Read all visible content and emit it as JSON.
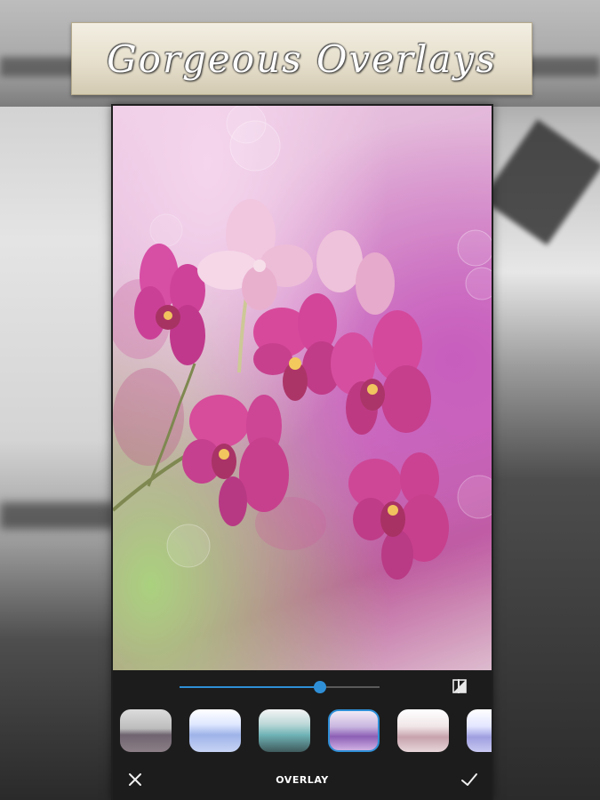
{
  "title": "Gorgeous Overlays",
  "editor": {
    "mode_label": "OVERLAY",
    "intensity_percent": 70
  },
  "icons": {
    "compare": "compare-icon",
    "close": "close-icon",
    "apply": "check-icon"
  },
  "colors": {
    "accent": "#2f8fd6",
    "panel": "#1c1c1c"
  },
  "overlays": [
    {
      "selected": false
    },
    {
      "selected": false
    },
    {
      "selected": false
    },
    {
      "selected": true
    },
    {
      "selected": false
    },
    {
      "selected": false
    }
  ]
}
